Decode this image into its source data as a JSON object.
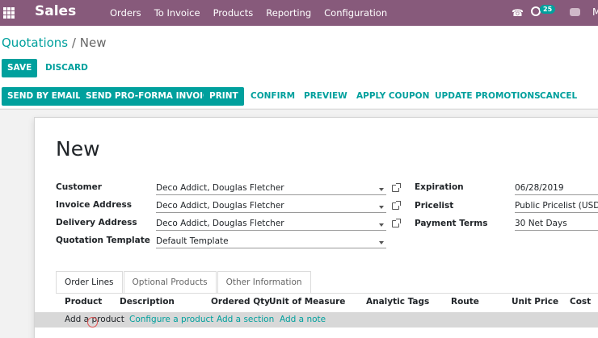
{
  "navbar": {
    "app_title": "Sales",
    "menu": [
      "Orders",
      "To Invoice",
      "Products",
      "Reporting",
      "Configuration"
    ],
    "activity_count": "25",
    "user_initial": "M",
    "color": "#875a7b"
  },
  "breadcrumb": {
    "parent": "Quotations",
    "separator": "/",
    "current": "New"
  },
  "actions": {
    "save": "SAVE",
    "discard": "DISCARD"
  },
  "status_buttons": {
    "send_by_email": "SEND BY EMAIL",
    "send_pro_forma": "SEND PRO-FORMA INVOICE",
    "print": "PRINT",
    "confirm": "CONFIRM",
    "preview": "PREVIEW",
    "apply_coupon": "APPLY COUPON",
    "update_promotions": "UPDATE PROMOTIONS",
    "cancel": "CANCEL"
  },
  "form": {
    "title": "New",
    "customer": {
      "label": "Customer",
      "value": "Deco Addict, Douglas Fletcher"
    },
    "invoice_address": {
      "label": "Invoice Address",
      "value": "Deco Addict, Douglas Fletcher"
    },
    "delivery_address": {
      "label": "Delivery Address",
      "value": "Deco Addict, Douglas Fletcher"
    },
    "quotation_template": {
      "label": "Quotation Template",
      "value": "Default Template"
    },
    "expiration": {
      "label": "Expiration",
      "value": "06/28/2019"
    },
    "pricelist": {
      "label": "Pricelist",
      "value": "Public Pricelist (USD)"
    },
    "payment_terms": {
      "label": "Payment Terms",
      "value": "30 Net Days"
    }
  },
  "tabs": [
    "Order Lines",
    "Optional Products",
    "Other Information"
  ],
  "table": {
    "columns": [
      "Product",
      "Description",
      "Ordered Qty",
      "Unit of Measure",
      "Analytic Tags",
      "Route",
      "Unit Price",
      "Cost"
    ],
    "add_links": [
      "Add a product",
      "Configure a product",
      "Add a section",
      "Add a note"
    ]
  },
  "colors": {
    "accent": "#00a09d",
    "navbar": "#875a7b"
  },
  "icons": [
    "apps-grid-icon",
    "phone-icon",
    "activity-clock-icon",
    "chat-icon",
    "caret-down-icon",
    "external-link-icon"
  ]
}
